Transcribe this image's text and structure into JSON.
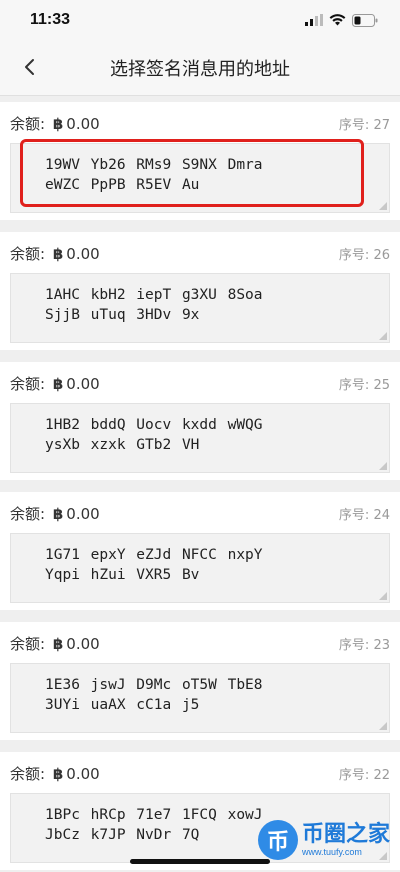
{
  "status": {
    "time": "11:33"
  },
  "nav": {
    "title": "选择签名消息用的地址"
  },
  "labels": {
    "balance": "余额:",
    "btc_symbol": "฿",
    "seq": "序号:"
  },
  "addresses": [
    {
      "balance": "0.00",
      "seq": "27",
      "line1": "19WV Yb26 RMs9 S9NX Dmra",
      "line2": "eWZC PpPB R5EV Au"
    },
    {
      "balance": "0.00",
      "seq": "26",
      "line1": "1AHC kbH2 iepT g3XU 8Soa",
      "line2": "SjjB uTuq 3HDv 9x"
    },
    {
      "balance": "0.00",
      "seq": "25",
      "line1": "1HB2 bddQ Uocv kxdd wWQG",
      "line2": "ysXb xzxk GTb2 VH"
    },
    {
      "balance": "0.00",
      "seq": "24",
      "line1": "1G71 epxY eZJd NFCC nxpY",
      "line2": "Yqpi hZui VXR5 Bv"
    },
    {
      "balance": "0.00",
      "seq": "23",
      "line1": "1E36 jswJ D9Mc oT5W TbE8",
      "line2": "3UYi uaAX cC1a j5"
    },
    {
      "balance": "0.00",
      "seq": "22",
      "line1": "1BPc hRCp 71e7 1FCQ xowJ",
      "line2": "JbCz k7JP NvDr 7Q"
    }
  ],
  "watermark": {
    "logo_char": "币",
    "name": "币圈之家",
    "url": "www.tuufy.com"
  },
  "colors": {
    "highlight": "#e0201c",
    "watermark": "#1f7ad8"
  }
}
